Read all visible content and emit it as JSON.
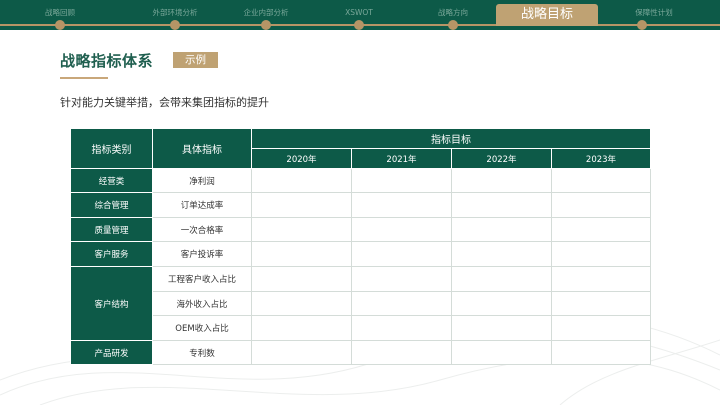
{
  "nav": {
    "items": [
      {
        "label": "战略回顾"
      },
      {
        "label": "外部环境分析"
      },
      {
        "label": "企业内部分析"
      },
      {
        "label": "XSWOT"
      },
      {
        "label": "战略方向"
      },
      {
        "label": "战略目标"
      },
      {
        "label": "保障性计划"
      }
    ],
    "active_index": 5
  },
  "page": {
    "title": "战略指标体系",
    "tag": "示例",
    "subtitle": "针对能力关键举措，会带来集团指标的提升"
  },
  "table": {
    "header_category": "指标类别",
    "header_indicator": "具体指标",
    "header_targets": "指标目标",
    "years": [
      "2020年",
      "2021年",
      "2022年",
      "2023年"
    ],
    "groups": [
      {
        "category": "经营类",
        "indicators": [
          "净利润"
        ]
      },
      {
        "category": "综合管理",
        "indicators": [
          "订单达成率"
        ]
      },
      {
        "category": "质量管理",
        "indicators": [
          "一次合格率"
        ]
      },
      {
        "category": "客户服务",
        "indicators": [
          "客户投诉率"
        ]
      },
      {
        "category": "客户结构",
        "indicators": [
          "工程客户收入占比",
          "海外收入占比",
          "OEM收入占比"
        ]
      },
      {
        "category": "产品研发",
        "indicators": [
          "专利数"
        ]
      }
    ]
  },
  "colors": {
    "brand_green": "#0d5a48",
    "gold": "#bfa273"
  }
}
